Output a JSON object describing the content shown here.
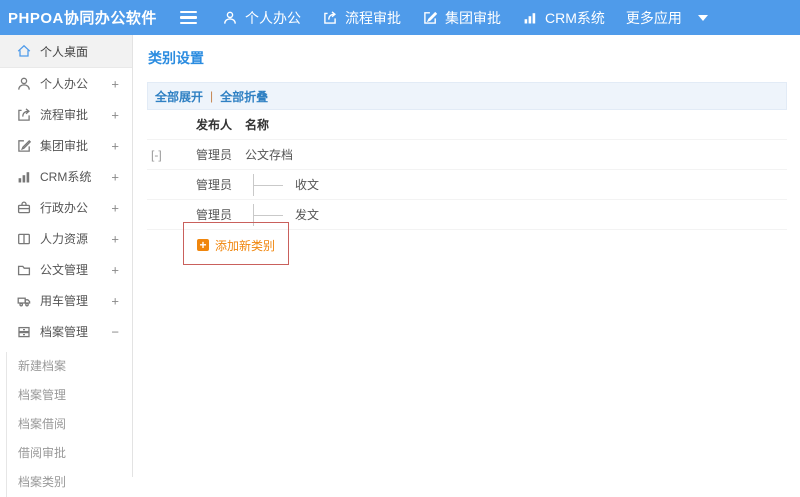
{
  "topbar": {
    "logo": "PHPOA协同办公软件",
    "nav": [
      {
        "label": "个人办公",
        "icon": "person-icon"
      },
      {
        "label": "流程审批",
        "icon": "flow-icon"
      },
      {
        "label": "集团审批",
        "icon": "edit-icon"
      },
      {
        "label": "CRM系统",
        "icon": "chart-icon"
      }
    ],
    "more": {
      "label": "更多应用",
      "icon": "caret-down-icon"
    }
  },
  "sidebar": {
    "items": [
      {
        "label": "个人桌面",
        "icon": "home-icon",
        "expand": "",
        "active": true
      },
      {
        "label": "个人办公",
        "icon": "person-icon",
        "expand": "+"
      },
      {
        "label": "流程审批",
        "icon": "flow-icon",
        "expand": "+"
      },
      {
        "label": "集团审批",
        "icon": "edit-icon",
        "expand": "+"
      },
      {
        "label": "CRM系统",
        "icon": "chart-icon",
        "expand": "+"
      },
      {
        "label": "行政办公",
        "icon": "briefcase-icon",
        "expand": "+"
      },
      {
        "label": "人力资源",
        "icon": "book-icon",
        "expand": "+"
      },
      {
        "label": "公文管理",
        "icon": "folder-icon",
        "expand": "+"
      },
      {
        "label": "用车管理",
        "icon": "truck-icon",
        "expand": "+"
      },
      {
        "label": "档案管理",
        "icon": "archive-icon",
        "expand": "−"
      }
    ],
    "submenu": [
      {
        "label": "新建档案"
      },
      {
        "label": "档案管理"
      },
      {
        "label": "档案借阅"
      },
      {
        "label": "借阅审批"
      },
      {
        "label": "档案类别"
      }
    ]
  },
  "main": {
    "title": "类别设置",
    "toolbar": {
      "expand_all": "全部展开",
      "separator": "|",
      "collapse_all": "全部折叠"
    },
    "table": {
      "headers": {
        "publisher": "发布人",
        "name": "名称"
      },
      "rows": [
        {
          "expander": "[-]",
          "publisher": "管理员",
          "name": "公文存档"
        },
        {
          "expander": "",
          "publisher": "管理员",
          "name": "收文"
        },
        {
          "expander": "",
          "publisher": "管理员",
          "name": "发文"
        }
      ]
    },
    "add_category": {
      "label": "添加新类别",
      "icon": "plus-icon"
    }
  },
  "colors": {
    "topbar_bg": "#4f9bea",
    "title_blue": "#2b8ce0",
    "link_blue": "#2f80c3",
    "orange": "#f0860d",
    "highlight_border": "#c9605c"
  }
}
